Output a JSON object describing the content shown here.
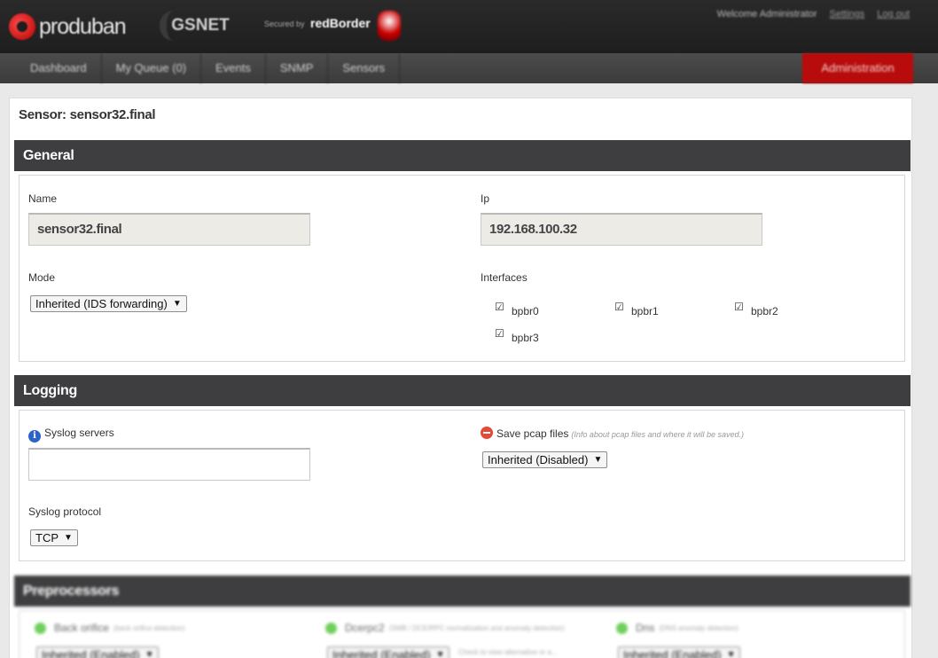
{
  "header": {
    "brand": "produban",
    "product": "GSNET",
    "secured_by": "Secured by",
    "secured_brand": "redBorder",
    "welcome": "Welcome Administrator",
    "settings_link": "Settings",
    "logout_link": "Log out"
  },
  "nav": {
    "items": [
      "Dashboard",
      "My Queue (0)",
      "Events",
      "SNMP",
      "Sensors"
    ],
    "admin": "Administration"
  },
  "page": {
    "title": "Sensor: sensor32.final"
  },
  "general": {
    "heading": "General",
    "name_label": "Name",
    "name_value": "sensor32.final",
    "ip_label": "Ip",
    "ip_value": "192.168.100.32",
    "mode_label": "Mode",
    "mode_value": "Inherited (IDS forwarding)",
    "interfaces_label": "Interfaces",
    "interfaces": [
      {
        "name": "bpbr0",
        "checked": true
      },
      {
        "name": "bpbr1",
        "checked": true
      },
      {
        "name": "bpbr2",
        "checked": true
      },
      {
        "name": "bpbr3",
        "checked": true
      }
    ]
  },
  "logging": {
    "heading": "Logging",
    "syslog_servers_label": "Syslog servers",
    "syslog_servers_value": "",
    "save_pcap_label": "Save pcap files",
    "save_pcap_hint": "(Info about pcap files and where it will be saved.)",
    "save_pcap_value": "Inherited (Disabled)",
    "syslog_protocol_label": "Syslog protocol",
    "syslog_protocol_value": "TCP"
  },
  "preprocessors": {
    "heading": "Preprocessors",
    "items": [
      {
        "name": "Back orifice",
        "hint": "(back orifice detection)",
        "value": "Inherited (Enabled)"
      },
      {
        "name": "Dcerpc2",
        "hint": "(SMB / DCE/RPC normalization and anomaly detection)",
        "value": "Inherited (Enabled)",
        "note": "Check to view alternative or a..."
      },
      {
        "name": "Dns",
        "hint": "(DNS anomaly detection)",
        "value": "Inherited (Enabled)"
      }
    ]
  },
  "colors": {
    "header_bg": "#1e1e1e",
    "nav_bg": "#444444",
    "admin_accent": "#b80c0c",
    "section_head_bg": "#3e3e40",
    "status_enabled": "#6fcf5a"
  }
}
